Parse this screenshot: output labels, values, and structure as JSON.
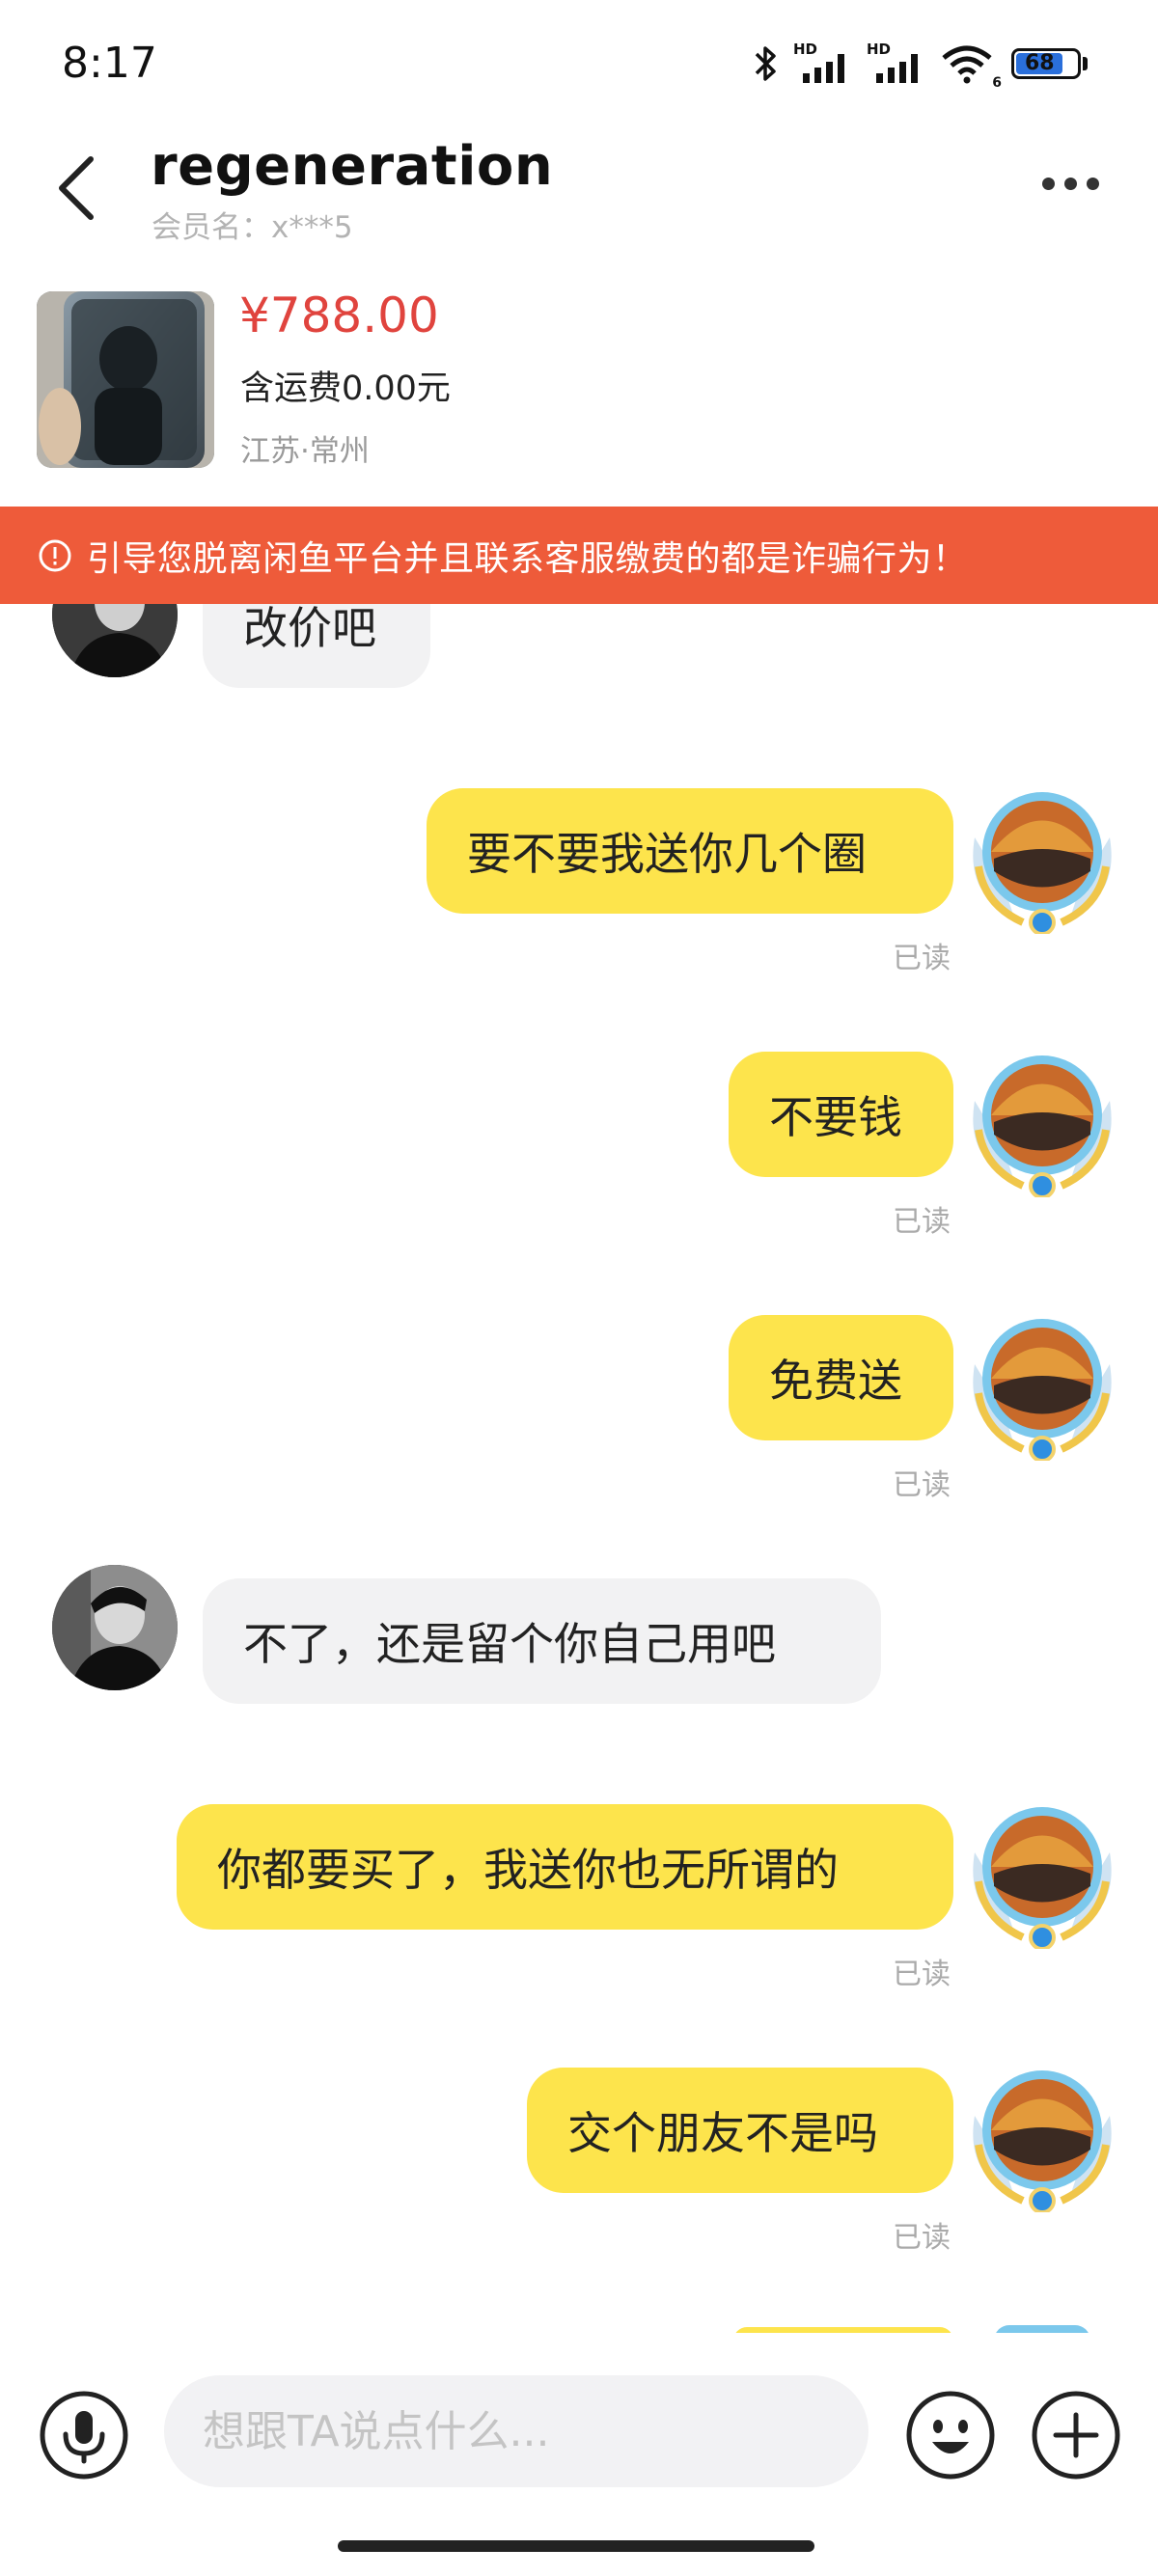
{
  "status_bar": {
    "time": "8:17",
    "icons": [
      "bluetooth-icon",
      "signal-hd-icon",
      "signal-hd-icon",
      "wifi-icon",
      "battery-icon"
    ],
    "network_labels": [
      "HD",
      "HD"
    ],
    "wifi_label": "6",
    "battery": "68"
  },
  "header": {
    "title": "regeneration",
    "member_label": "会员名：x***5",
    "back_icon": "back-arrow-icon",
    "more_icon": "more-dots-icon"
  },
  "product": {
    "price": "¥788.00",
    "shipping": "含运费0.00元",
    "location": "江苏·常州"
  },
  "warning": {
    "text": "引导您脱离闲鱼平台并且联系客服缴费的都是诈骗行为！",
    "color": "#ee5b3a"
  },
  "messages": [
    {
      "side": "them",
      "text": "改价吧"
    },
    {
      "side": "me",
      "text": "要不要我送你几个圈",
      "status": "已读"
    },
    {
      "side": "me",
      "text": "不要钱",
      "status": "已读"
    },
    {
      "side": "me",
      "text": "免费送",
      "status": "已读"
    },
    {
      "side": "them",
      "text": "不了，还是留个你自己用吧"
    },
    {
      "side": "me",
      "text": "你都要买了，我送你也无所谓的",
      "status": "已读"
    },
    {
      "side": "me",
      "text": "交个朋友不是吗",
      "status": "已读"
    }
  ],
  "input": {
    "placeholder": "想跟TA说点什么..."
  },
  "colors": {
    "my_bubble": "#fde44c",
    "their_bubble": "#f2f2f3",
    "price": "#e0443e"
  }
}
